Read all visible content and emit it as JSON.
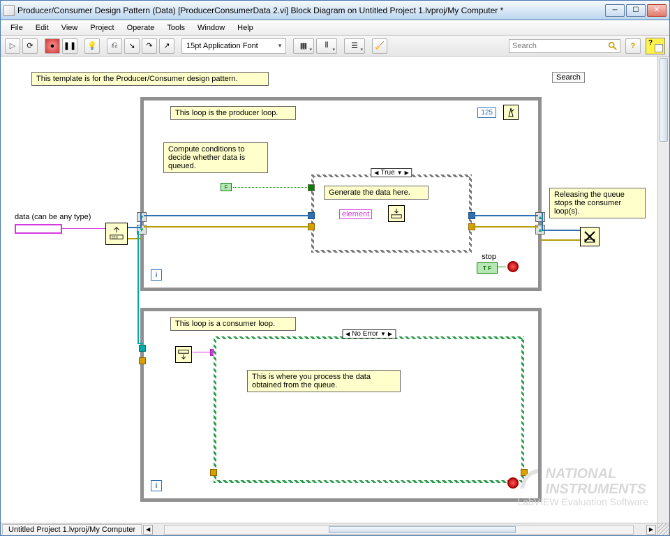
{
  "window": {
    "title": "Producer/Consumer Design Pattern (Data) [ProducerConsumerData 2.vi] Block Diagram on Untitled Project 1.lvproj/My Computer *",
    "minimize": "─",
    "maximize": "☐",
    "close": "✕"
  },
  "menu": {
    "file": "File",
    "edit": "Edit",
    "view": "View",
    "project": "Project",
    "operate": "Operate",
    "tools": "Tools",
    "window": "Window",
    "help": "Help"
  },
  "toolbar": {
    "font": "15pt Application Font",
    "search_placeholder": "Search",
    "help": "?"
  },
  "diagram": {
    "top_comment": "This template is for the Producer/Consumer design pattern.",
    "search_button": "Search",
    "data_label": "data (can be any type)",
    "producer": {
      "title_comment": "This loop is the producer loop.",
      "compute_comment": "Compute conditions to decide whether data is queued.",
      "generate_comment": "Generate the data here.",
      "case_selector": "True",
      "wait_ms": "125",
      "false_const": "F",
      "element_label": "element",
      "stop_label": "stop",
      "stop_tf": "T F",
      "iter": "i"
    },
    "release_comment": "Releasing the queue stops the consumer loop(s).",
    "consumer": {
      "title_comment": "This loop is a consumer loop.",
      "case_selector": "No Error",
      "process_comment": "This is where you process the data obtained from the queue.",
      "iter": "i"
    }
  },
  "statusbar": {
    "path": "Untitled Project 1.lvproj/My Computer"
  },
  "watermark": {
    "line1": "NATIONAL",
    "line2": "INSTRUMENTS",
    "line3": "LabVIEW  Evaluation Software"
  }
}
